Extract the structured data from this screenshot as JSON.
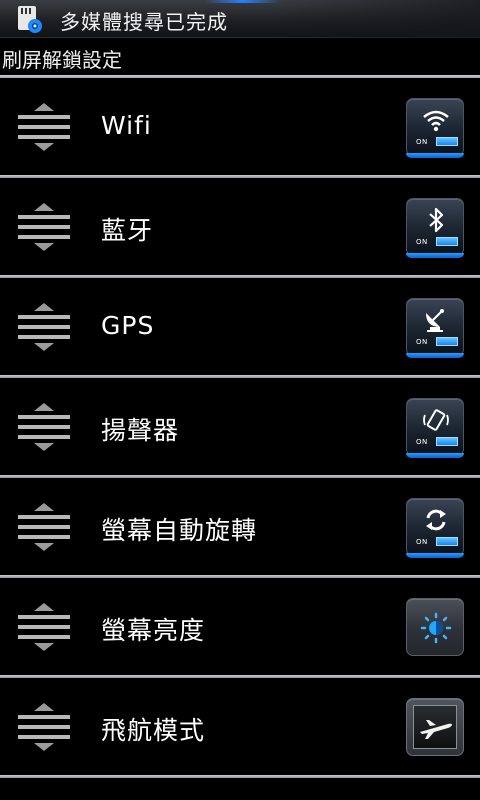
{
  "status_bar": {
    "notification_text": "多媒體搜尋已完成",
    "icon": "sd-card-settings-icon"
  },
  "page": {
    "title": "刷屏解鎖設定"
  },
  "items": [
    {
      "label": "Wifi",
      "toggle_icon": "wifi-icon",
      "state": "ON"
    },
    {
      "label": "藍牙",
      "toggle_icon": "bluetooth-icon",
      "state": "ON"
    },
    {
      "label": "GPS",
      "toggle_icon": "gps-satellite-icon",
      "state": "ON"
    },
    {
      "label": "揚聲器",
      "toggle_icon": "vibrate-phone-icon",
      "state": "ON"
    },
    {
      "label": "螢幕自動旋轉",
      "toggle_icon": "auto-rotate-icon",
      "state": "ON"
    },
    {
      "label": "螢幕亮度",
      "toggle_icon": "brightness-icon"
    },
    {
      "label": "飛航模式",
      "toggle_icon": "airplane-icon"
    }
  ],
  "colors": {
    "accent": "#1b86ea",
    "divider": "#c8ccd2",
    "background": "#000000"
  }
}
